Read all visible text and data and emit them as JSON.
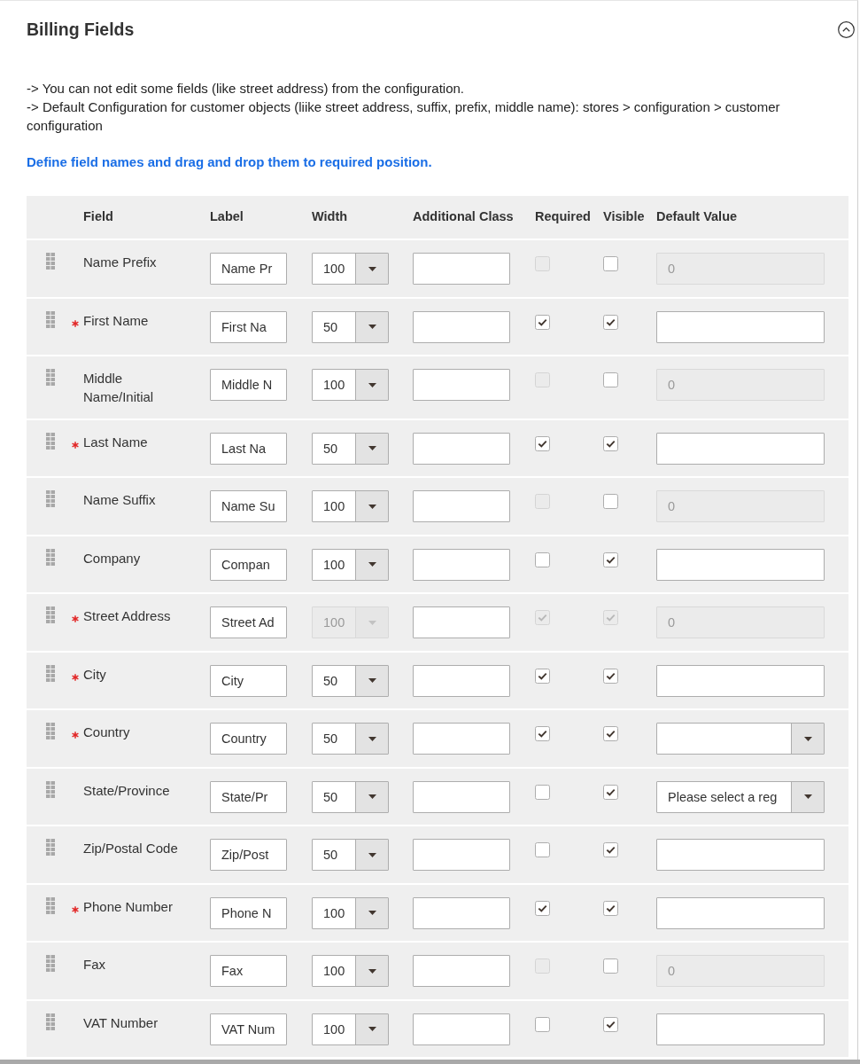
{
  "section": {
    "title": "Billing Fields",
    "expanded": true
  },
  "notes": [
    "-> You can not edit some fields (like street address) from the configuration.",
    "-> Default Configuration for customer objects (liike street address, suffix, prefix, middle name): stores > configuration > customer configuration"
  ],
  "instruction": "Define field names and drag and drop them to required position.",
  "table": {
    "columns": [
      "Field",
      "Label",
      "Width",
      "Additional Class",
      "Required",
      "Visible",
      "Default Value"
    ],
    "rows": [
      {
        "field": "Name Prefix",
        "required_marker": false,
        "label": "Name Pr",
        "width": {
          "value": "100",
          "disabled": false
        },
        "required": {
          "checked": false,
          "disabled": true
        },
        "visible": {
          "checked": false,
          "disabled": false
        },
        "default_value": {
          "kind": "input",
          "disabled": true,
          "value": "0"
        }
      },
      {
        "field": "First Name",
        "required_marker": true,
        "label": "First Na",
        "width": {
          "value": "50",
          "disabled": false
        },
        "required": {
          "checked": true,
          "disabled": false
        },
        "visible": {
          "checked": true,
          "disabled": false
        },
        "default_value": {
          "kind": "input",
          "disabled": false
        }
      },
      {
        "field": "Middle Name/Initial",
        "required_marker": false,
        "label": "Middle N",
        "width": {
          "value": "100",
          "disabled": false
        },
        "required": {
          "checked": false,
          "disabled": true
        },
        "visible": {
          "checked": false,
          "disabled": false
        },
        "default_value": {
          "kind": "input",
          "disabled": true,
          "value": "0"
        }
      },
      {
        "field": "Last Name",
        "required_marker": true,
        "label": "Last Na",
        "width": {
          "value": "50",
          "disabled": false
        },
        "required": {
          "checked": true,
          "disabled": false
        },
        "visible": {
          "checked": true,
          "disabled": false
        },
        "default_value": {
          "kind": "input",
          "disabled": false
        }
      },
      {
        "field": "Name Suffix",
        "required_marker": false,
        "label": "Name Su",
        "width": {
          "value": "100",
          "disabled": false
        },
        "required": {
          "checked": false,
          "disabled": true
        },
        "visible": {
          "checked": false,
          "disabled": false
        },
        "default_value": {
          "kind": "input",
          "disabled": true,
          "value": "0"
        }
      },
      {
        "field": "Company",
        "required_marker": false,
        "label": "Compan",
        "width": {
          "value": "100",
          "disabled": false
        },
        "required": {
          "checked": false,
          "disabled": false
        },
        "visible": {
          "checked": true,
          "disabled": false
        },
        "default_value": {
          "kind": "input",
          "disabled": false
        }
      },
      {
        "field": "Street Address",
        "required_marker": true,
        "label": "Street Ad",
        "width": {
          "value": "100",
          "disabled": true
        },
        "required": {
          "checked": true,
          "disabled": true
        },
        "visible": {
          "checked": true,
          "disabled": true
        },
        "default_value": {
          "kind": "input",
          "disabled": true,
          "value": "0"
        }
      },
      {
        "field": "City",
        "required_marker": true,
        "label": "City",
        "width": {
          "value": "50",
          "disabled": false
        },
        "required": {
          "checked": true,
          "disabled": false
        },
        "visible": {
          "checked": true,
          "disabled": false
        },
        "default_value": {
          "kind": "input",
          "disabled": false
        }
      },
      {
        "field": "Country",
        "required_marker": true,
        "label": "Country",
        "width": {
          "value": "50",
          "disabled": false
        },
        "required": {
          "checked": true,
          "disabled": false
        },
        "visible": {
          "checked": true,
          "disabled": false
        },
        "default_value": {
          "kind": "select",
          "disabled": false
        }
      },
      {
        "field": "State/Province",
        "required_marker": false,
        "label": "State/Pr",
        "width": {
          "value": "50",
          "disabled": false
        },
        "required": {
          "checked": false,
          "disabled": false
        },
        "visible": {
          "checked": true,
          "disabled": false
        },
        "default_value": {
          "kind": "select",
          "disabled": false,
          "value": "Please select a reg"
        }
      },
      {
        "field": "Zip/Postal Code",
        "required_marker": false,
        "label": "Zip/Post",
        "width": {
          "value": "50",
          "disabled": false
        },
        "required": {
          "checked": false,
          "disabled": false
        },
        "visible": {
          "checked": true,
          "disabled": false
        },
        "default_value": {
          "kind": "input",
          "disabled": false
        }
      },
      {
        "field": "Phone Number",
        "required_marker": true,
        "label": "Phone N",
        "width": {
          "value": "100",
          "disabled": false
        },
        "required": {
          "checked": true,
          "disabled": false
        },
        "visible": {
          "checked": true,
          "disabled": false
        },
        "default_value": {
          "kind": "input",
          "disabled": false
        }
      },
      {
        "field": "Fax",
        "required_marker": false,
        "label": "Fax",
        "width": {
          "value": "100",
          "disabled": false
        },
        "required": {
          "checked": false,
          "disabled": true
        },
        "visible": {
          "checked": false,
          "disabled": false
        },
        "default_value": {
          "kind": "input",
          "disabled": true,
          "value": "0"
        }
      },
      {
        "field": "VAT Number",
        "required_marker": false,
        "label": "VAT Num",
        "width": {
          "value": "100",
          "disabled": false
        },
        "required": {
          "checked": false,
          "disabled": false
        },
        "visible": {
          "checked": true,
          "disabled": false
        },
        "default_value": {
          "kind": "input",
          "disabled": false
        }
      }
    ]
  }
}
